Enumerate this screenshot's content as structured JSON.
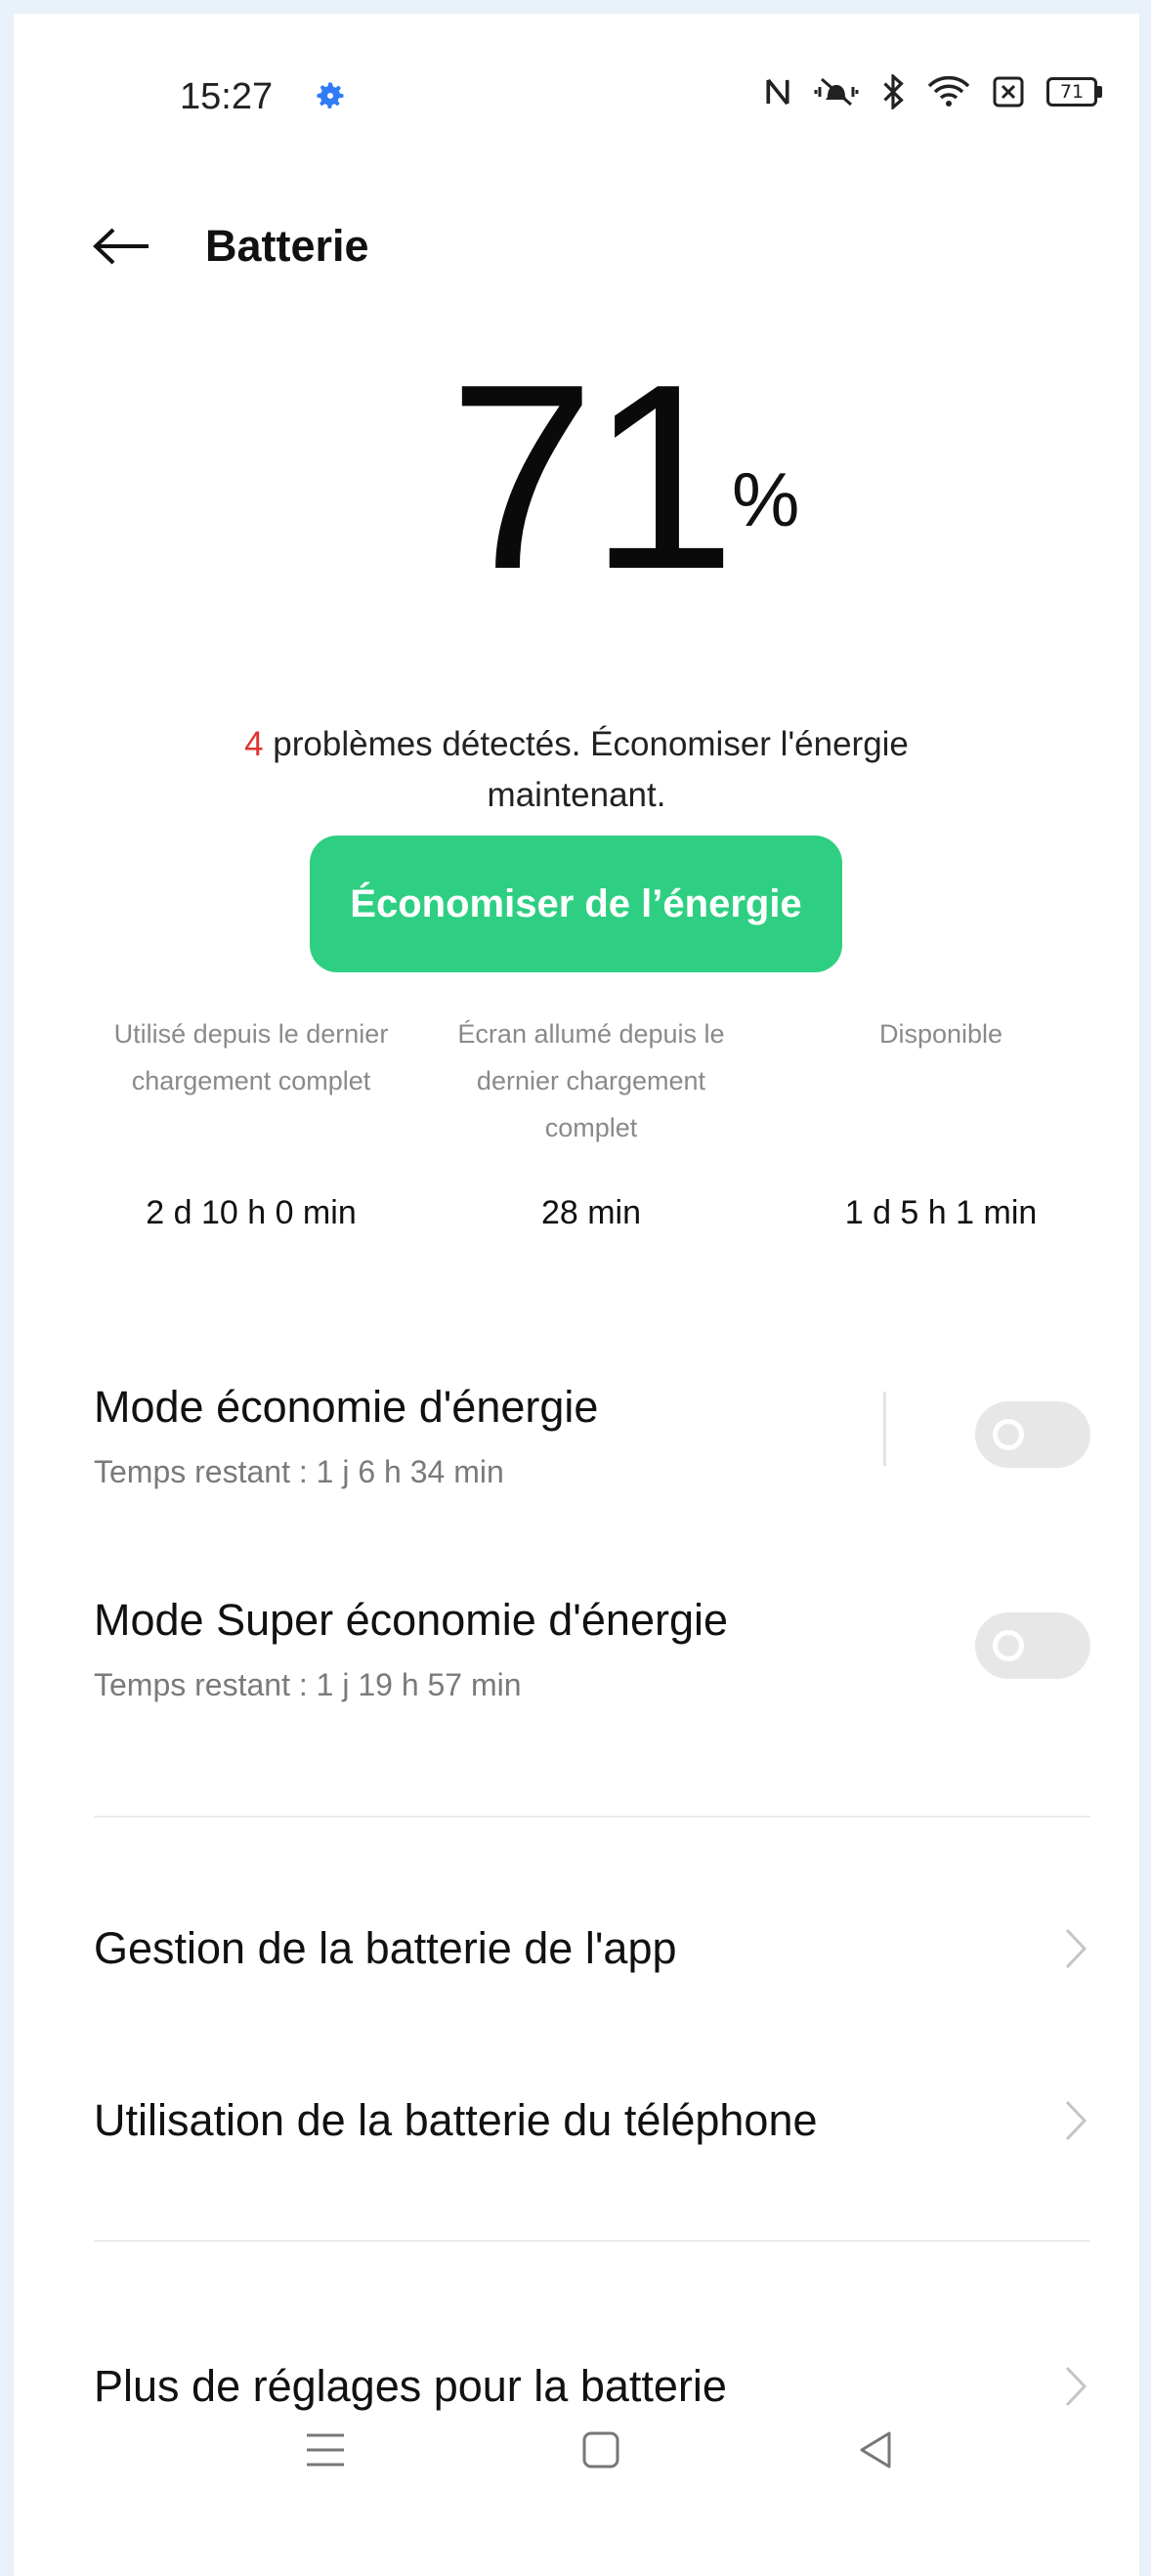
{
  "status_bar": {
    "time": "15:27",
    "icons": [
      "settings-gear-icon",
      "nfc-icon",
      "vibrate-icon",
      "bluetooth-icon",
      "wifi-icon",
      "sim-off-icon",
      "battery-icon"
    ],
    "battery_level": "71",
    "colors": {
      "gear": "#2f7cf6"
    }
  },
  "header": {
    "title": "Batterie"
  },
  "battery": {
    "percent": "71",
    "percent_sign": "%"
  },
  "problems": {
    "count": "4",
    "text": " problèmes détectés. Économiser l'énergie maintenant."
  },
  "save_button": {
    "label": "Économiser de l’énergie",
    "color": "#2ecf82"
  },
  "stats": [
    {
      "label": "Utilisé depuis le dernier chargement complet",
      "value": "2 d 10 h 0 min"
    },
    {
      "label": "Écran allumé depuis le dernier chargement complet",
      "value": "28 min"
    },
    {
      "label": "Disponible",
      "value": "1 d 5 h 1 min"
    }
  ],
  "modes": [
    {
      "title": "Mode économie d'énergie",
      "subtitle": "Temps restant :  1 j 6 h 34 min",
      "enabled": false
    },
    {
      "title": "Mode Super économie d'énergie",
      "subtitle": "Temps restant :  1 j 19 h 57 min",
      "enabled": false
    }
  ],
  "menu": [
    {
      "label": "Gestion de la batterie de l'app"
    },
    {
      "label": "Utilisation de la batterie du téléphone"
    },
    {
      "label": "Plus de réglages pour la batterie"
    }
  ],
  "system_nav": {
    "icons": [
      "menu-icon",
      "home-icon",
      "back-icon"
    ]
  }
}
